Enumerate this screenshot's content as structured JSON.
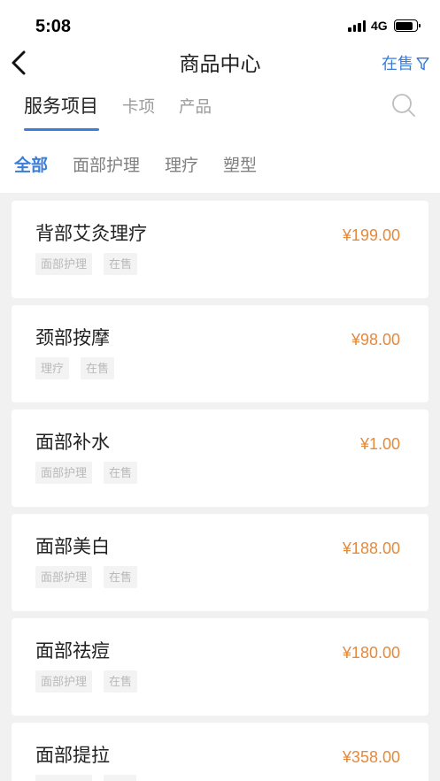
{
  "status_bar": {
    "time": "5:08",
    "network": "4G",
    "battery_level": 0.85
  },
  "icons": {
    "signal": "cellular-signal-icon",
    "battery": "battery-icon",
    "back": "chevron-left-icon",
    "filter": "funnel-icon",
    "search": "search-icon"
  },
  "nav": {
    "title": "商品中心",
    "filter_label": "在售"
  },
  "tabs": [
    {
      "label": "服务项目",
      "active": true
    },
    {
      "label": "卡项",
      "active": false
    },
    {
      "label": "产品",
      "active": false
    }
  ],
  "categories": [
    {
      "label": "全部",
      "active": true
    },
    {
      "label": "面部护理",
      "active": false
    },
    {
      "label": "理疗",
      "active": false
    },
    {
      "label": "塑型",
      "active": false
    }
  ],
  "products": [
    {
      "name": "背部艾灸理疗",
      "price": "¥199.00",
      "tags": [
        "面部护理",
        "在售"
      ]
    },
    {
      "name": "颈部按摩",
      "price": "¥98.00",
      "tags": [
        "理疗",
        "在售"
      ]
    },
    {
      "name": "面部补水",
      "price": "¥1.00",
      "tags": [
        "面部护理",
        "在售"
      ]
    },
    {
      "name": "面部美白",
      "price": "¥188.00",
      "tags": [
        "面部护理",
        "在售"
      ]
    },
    {
      "name": "面部祛痘",
      "price": "¥180.00",
      "tags": [
        "面部护理",
        "在售"
      ]
    },
    {
      "name": "面部提拉",
      "price": "¥358.00"
    }
  ],
  "colors": {
    "accent": "#3b7dd8",
    "price": "#e38a3d",
    "tag_text": "#b9b9b9",
    "tag_bg": "#f3f3f3",
    "page_bg": "#f1f1f1",
    "text": "#222222"
  }
}
